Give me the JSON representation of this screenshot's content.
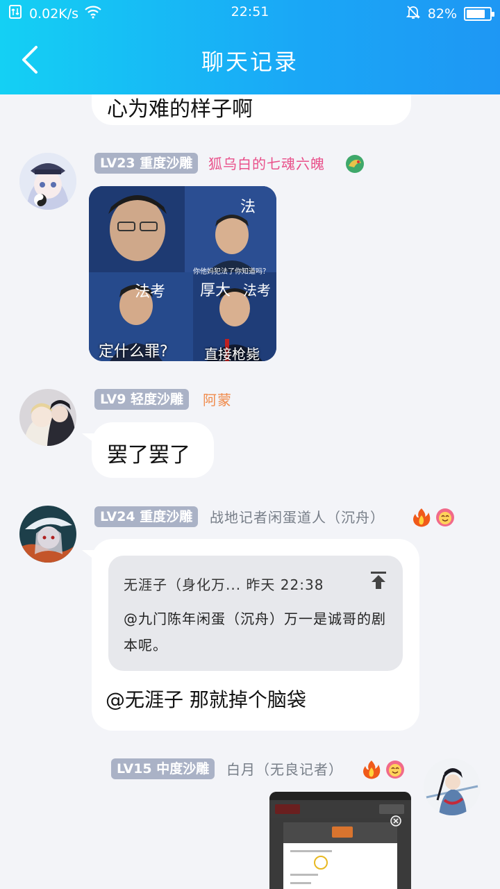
{
  "status": {
    "net_speed": "0.02K/s",
    "time": "22:51",
    "battery": "82%",
    "battery_level": 0.82
  },
  "nav": {
    "title": "聊天记录"
  },
  "messages": [
    {
      "text": "心为难的样子啊"
    },
    {
      "level": "LV23 重度沙雕",
      "nickname": "狐乌白的七魂六魄",
      "nick_color": "#e9508a",
      "meme_captions": [
        "你他妈犯法了你知道吗？",
        "定什么罪?",
        "直接枪毙"
      ],
      "meme_signs": [
        "法",
        "法考",
        "法考",
        "厚大"
      ]
    },
    {
      "level": "LV9 轻度沙雕",
      "nickname": "阿蒙",
      "nick_color": "#f08a4a",
      "text": "罢了罢了"
    },
    {
      "level": "LV24 重度沙雕",
      "nickname": "战地记者闲蛋道人（沉舟）",
      "nick_color": "#777e88",
      "quote_header": "无涯子（身化万... 昨天 22:38",
      "quote_body": "@九门陈年闲蛋（沉舟）万一是诚哥的剧本呢。",
      "text": "@无涯子 那就掉个脑袋"
    },
    {
      "level": "LV15 中度沙雕",
      "nickname": "白月（无良记者）",
      "nick_color": "#777e88"
    }
  ]
}
